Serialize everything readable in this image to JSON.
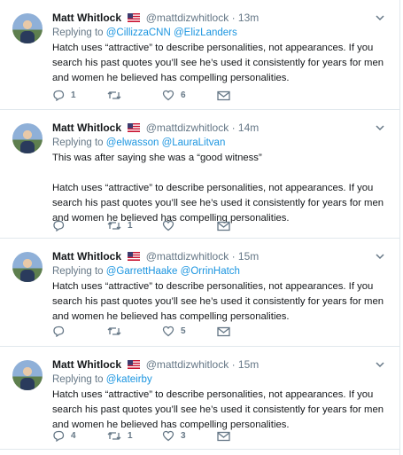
{
  "colors": {
    "link": "#1b95e0",
    "muted": "#657786",
    "text": "#14171a",
    "border": "#e1e8ed"
  },
  "tweets": [
    {
      "name": "Matt Whitlock",
      "handle": "@mattdizwhitlock",
      "dot": "·",
      "time": "13m",
      "replying_prefix": "Replying to",
      "mentions": [
        "@CillizzaCNN",
        "@ElizLanders"
      ],
      "paragraphs": [
        "Hatch uses “attractive” to describe personalities, not appearances. If you search his past quotes you’ll see he’s used it consistently for years for men and women he believed has compelling personalities."
      ],
      "replies": "1",
      "retweets": "",
      "likes": "6"
    },
    {
      "name": "Matt Whitlock",
      "handle": "@mattdizwhitlock",
      "dot": "·",
      "time": "14m",
      "replying_prefix": "Replying to",
      "mentions": [
        "@elwasson",
        "@LauraLitvan"
      ],
      "paragraphs": [
        "This was after saying she was a “good witness”",
        "Hatch uses “attractive” to describe personalities, not appearances. If you search his past quotes you’ll see he’s used it consistently for years for men and women he believed has compelling personalities."
      ],
      "replies": "",
      "retweets": "1",
      "likes": ""
    },
    {
      "name": "Matt Whitlock",
      "handle": "@mattdizwhitlock",
      "dot": "·",
      "time": "15m",
      "replying_prefix": "Replying to",
      "mentions": [
        "@GarrettHaake",
        "@OrrinHatch"
      ],
      "paragraphs": [
        "Hatch uses “attractive” to describe personalities, not appearances. If you search his past quotes you’ll see he’s used it consistently for years for men and women he believed has compelling personalities."
      ],
      "replies": "",
      "retweets": "",
      "likes": "5"
    },
    {
      "name": "Matt Whitlock",
      "handle": "@mattdizwhitlock",
      "dot": "·",
      "time": "15m",
      "replying_prefix": "Replying to",
      "mentions": [
        "@kateirby"
      ],
      "paragraphs": [
        "Hatch uses “attractive” to describe personalities, not appearances. If you search his past quotes you’ll see he’s used it consistently for years for men and women he believed has compelling personalities."
      ],
      "replies": "4",
      "retweets": "1",
      "likes": "3"
    }
  ]
}
